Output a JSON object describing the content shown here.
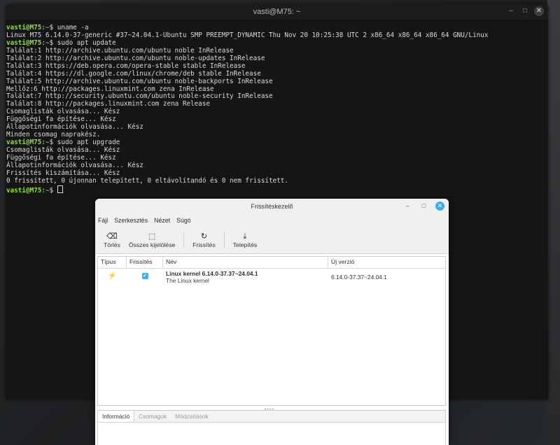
{
  "terminal": {
    "title": "vasti@M75: ~",
    "controls": {
      "minimize": "‒",
      "maximize": "□",
      "close": "✕"
    },
    "lines": [
      {
        "prompt": true,
        "user": "vasti@M75",
        "path": "~",
        "cmd": "uname -a"
      },
      {
        "prompt": false,
        "text": "Linux M75 6.14.0-37-generic #37~24.04.1-Ubuntu SMP PREEMPT_DYNAMIC Thu Nov 20 10:25:38 UTC 2 x86_64 x86_64 x86_64 GNU/Linux"
      },
      {
        "prompt": true,
        "user": "vasti@M75",
        "path": "~",
        "cmd": "sudo apt update"
      },
      {
        "prompt": false,
        "text": "Találat:1 http://archive.ubuntu.com/ubuntu noble InRelease"
      },
      {
        "prompt": false,
        "text": "Találat:2 http://archive.ubuntu.com/ubuntu noble-updates InRelease"
      },
      {
        "prompt": false,
        "text": "Találat:3 https://deb.opera.com/opera-stable stable InRelease"
      },
      {
        "prompt": false,
        "text": "Találat:4 https://dl.google.com/linux/chrome/deb stable InRelease"
      },
      {
        "prompt": false,
        "text": "Találat:5 http://archive.ubuntu.com/ubuntu noble-backports InRelease"
      },
      {
        "prompt": false,
        "text": "Mellőz:6 http://packages.linuxmint.com zena InRelease"
      },
      {
        "prompt": false,
        "text": "Találat:7 http://security.ubuntu.com/ubuntu noble-security InRelease"
      },
      {
        "prompt": false,
        "text": "Találat:8 http://packages.linuxmint.com zena Release"
      },
      {
        "prompt": false,
        "text": "Csomaglisták olvasása... Kész"
      },
      {
        "prompt": false,
        "text": "Függőségi fa építése... Kész"
      },
      {
        "prompt": false,
        "text": "Állapotinformációk olvasása... Kész"
      },
      {
        "prompt": false,
        "text": "Minden csomag naprakész."
      },
      {
        "prompt": true,
        "user": "vasti@M75",
        "path": "~",
        "cmd": "sudo apt upgrade"
      },
      {
        "prompt": false,
        "text": "Csomaglisták olvasása... Kész"
      },
      {
        "prompt": false,
        "text": "Függőségi fa építése... Kész"
      },
      {
        "prompt": false,
        "text": "Állapotinformációk olvasása... Kész"
      },
      {
        "prompt": false,
        "text": "Frissítés kiszámítása... Kész"
      },
      {
        "prompt": false,
        "text": "0 frissített, 0 újonnan telepített, 0 eltávolítandó és 0 nem frissített."
      },
      {
        "prompt": true,
        "user": "vasti@M75",
        "path": "~",
        "cmd": "",
        "cursor": true
      }
    ]
  },
  "update_manager": {
    "title": "Frissítéskezelő",
    "controls": {
      "minimize": "‒",
      "maximize": "□",
      "close": "✕"
    },
    "menu": [
      "Fájl",
      "Szerkesztés",
      "Nézet",
      "Súgó"
    ],
    "toolbar": [
      {
        "label": "Törlés",
        "icon": "clear-icon",
        "glyph": "⌫"
      },
      {
        "label": "Összes kijelölése",
        "icon": "select-all-icon",
        "glyph": "⬚"
      },
      {
        "label": "Frissítés",
        "icon": "refresh-icon",
        "glyph": "↻"
      },
      {
        "label": "Telepítés",
        "icon": "install-icon",
        "glyph": "⤓"
      }
    ],
    "columns": {
      "type": "Típus",
      "update": "Frissítés",
      "name": "Név",
      "new_version": "Új verzió"
    },
    "rows": [
      {
        "type_icon": "kernel-icon",
        "type_glyph": "⚡",
        "checked": true,
        "name": "Linux kernel 6.14.0-37.37~24.04.1",
        "description": "The Linux kernel",
        "new_version": "6.14.0-37.37~24.04.1"
      }
    ],
    "tabs": [
      "Információ",
      "Csomagok",
      "Módosítások"
    ],
    "active_tab": "Információ"
  }
}
